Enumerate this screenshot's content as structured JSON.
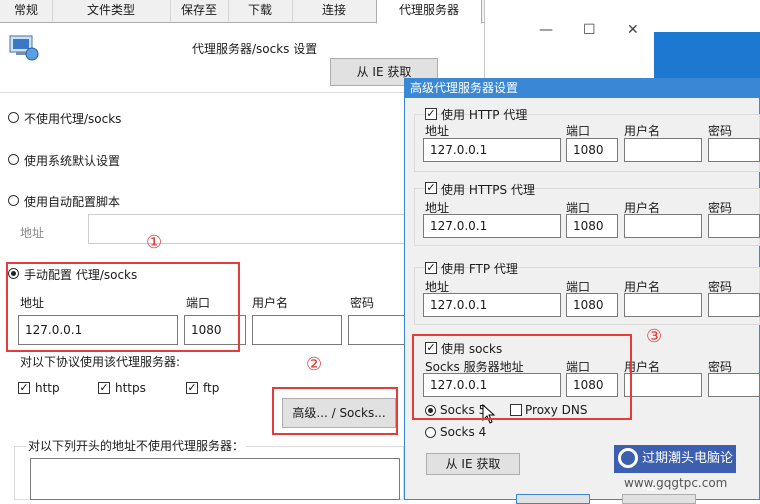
{
  "tabs": [
    "常规",
    "文件类型",
    "保存至",
    "下载",
    "连接",
    "代理服务器"
  ],
  "header": {
    "title": "代理服务器/socks 设置",
    "from_ie_button": "从 IE 获取"
  },
  "options": {
    "no_proxy": "不使用代理/socks",
    "system": "使用系统默认设置",
    "auto_script": "使用自动配置脚本",
    "address_label": "地址",
    "manual": "手动配置 代理/socks"
  },
  "manual": {
    "address_label": "地址",
    "port_label": "端口",
    "user_label": "用户名",
    "password_label": "密码",
    "address_value": "127.0.0.1",
    "port_value": "1080"
  },
  "protocols": {
    "label": "对以下协议使用该代理服务器:",
    "http": "http",
    "https": "https",
    "ftp": "ftp"
  },
  "advanced_button": "高级... / Socks...",
  "bypass_label": "对以下列开头的地址不使用代理服务器：",
  "annotations": [
    "①",
    "②",
    "③"
  ],
  "dialog": {
    "title": "高级代理服务器设置",
    "http": {
      "label": "使用 HTTP 代理",
      "address_label": "地址",
      "port_label": "端口",
      "user_label": "用户名",
      "password_label": "密码",
      "address": "127.0.0.1",
      "port": "1080"
    },
    "https": {
      "label": "使用 HTTPS 代理",
      "address_label": "地址",
      "port_label": "端口",
      "user_label": "用户名",
      "password_label": "密码",
      "address": "127.0.0.1",
      "port": "1080"
    },
    "ftp": {
      "label": "使用 FTP 代理",
      "address_label": "地址",
      "port_label": "端口",
      "user_label": "用户名",
      "password_label": "密码",
      "address": "127.0.0.1",
      "port": "1080"
    },
    "socks": {
      "label": "使用 socks",
      "address_label": "Socks 服务器地址",
      "port_label": "端口",
      "user_label": "用户名",
      "password_label": "密码",
      "address": "127.0.0.1",
      "port": "1080",
      "socks5": "Socks 5",
      "proxy_dns": "Proxy DNS",
      "socks4": "Socks 4"
    },
    "from_ie_button": "从 IE 获取"
  },
  "watermark": {
    "logo_text": "过期潮头电脑论坛",
    "site": "www.gqgtpc.com"
  }
}
